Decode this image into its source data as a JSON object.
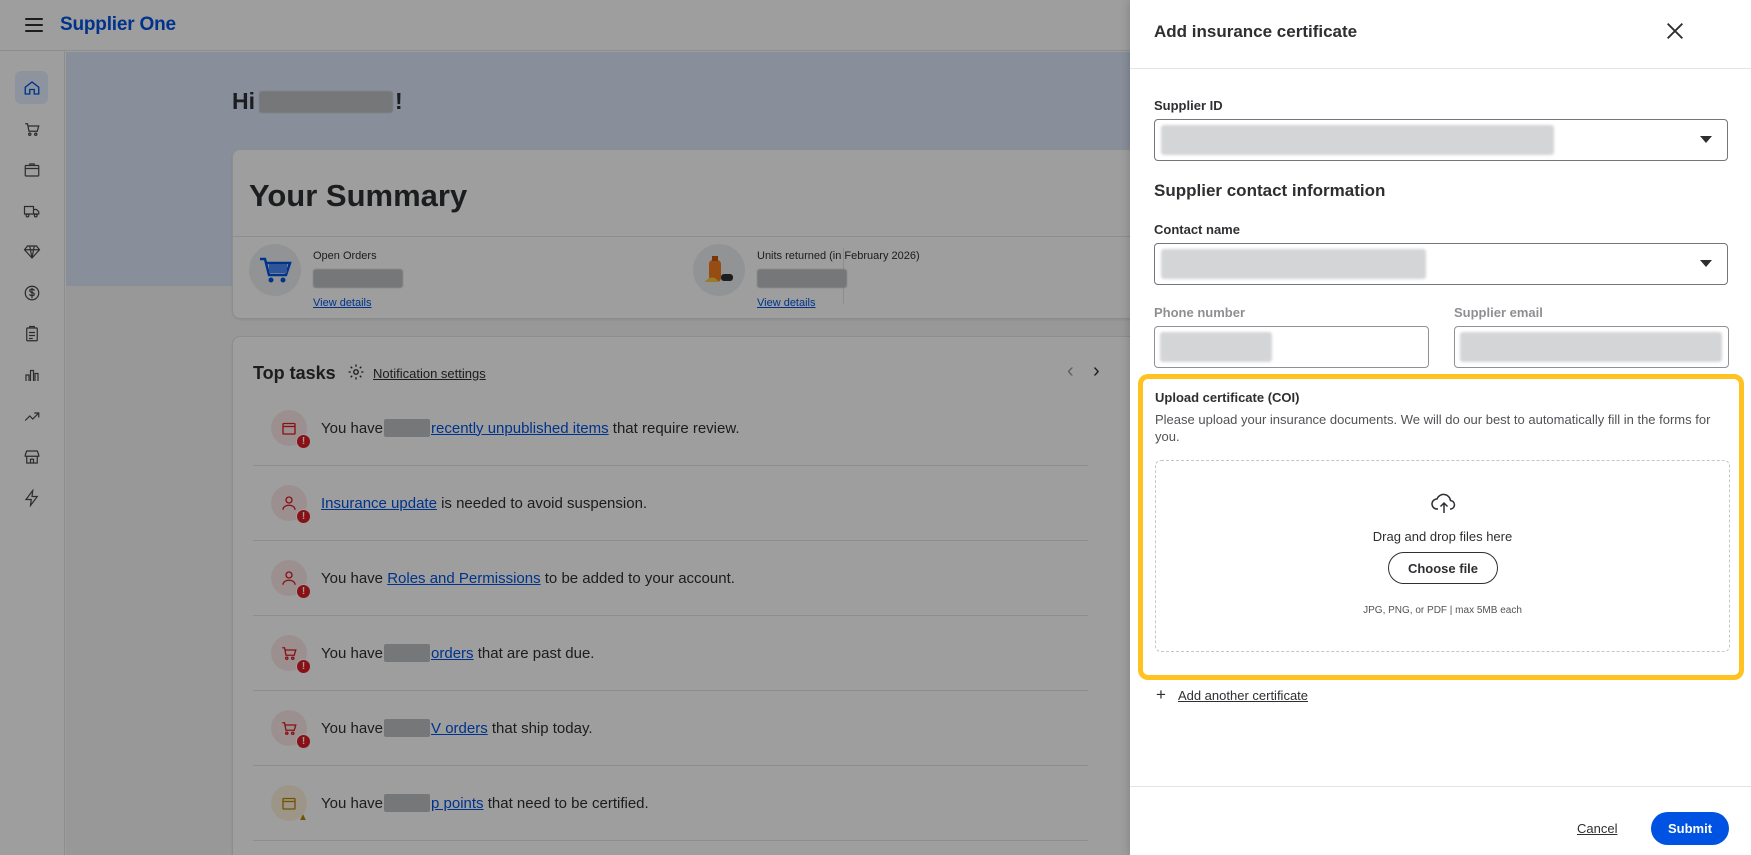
{
  "app": {
    "brand": "Supplier One"
  },
  "home": {
    "greeting_prefix": "Hi",
    "greeting_suffix": "!",
    "summary_title": "Your Summary",
    "metrics": [
      {
        "label": "Open Orders",
        "link": "View details"
      },
      {
        "label": "Units returned (in February 2026)",
        "link": "View details"
      }
    ],
    "tasks_title": "Top tasks",
    "notification_settings": "Notification settings",
    "tasks": [
      {
        "pre": "You have",
        "link": "recently unpublished items",
        "post": "that require review."
      },
      {
        "pre": "",
        "link": "Insurance update",
        "post": "is needed to avoid suspension."
      },
      {
        "pre": "You have",
        "link": "Roles and Permissions",
        "post": "to be added to your account."
      },
      {
        "pre": "You have",
        "link": "orders",
        "post": "that are past due."
      },
      {
        "pre": "You have",
        "link": "V orders",
        "post": "that ship today."
      },
      {
        "pre": "You have",
        "link": "p points",
        "post": "that need to be certified."
      }
    ]
  },
  "drawer": {
    "title": "Add insurance certificate",
    "supplier_id_label": "Supplier ID",
    "contact_section_title": "Supplier contact information",
    "contact_name_label": "Contact name",
    "phone_label": "Phone number",
    "email_label": "Supplier email",
    "upload": {
      "title": "Upload certificate (COI)",
      "description": "Please upload your insurance documents. We will do our best to automatically fill in the forms for you.",
      "drop_text": "Drag and drop files here",
      "choose_button": "Choose file",
      "hint": "JPG, PNG, or PDF | max 5MB each"
    },
    "add_another": "Add another certificate",
    "cancel": "Cancel",
    "submit": "Submit"
  },
  "colors": {
    "brand": "#0053e2",
    "highlight": "#ffc220",
    "alert": "#de1c24"
  }
}
